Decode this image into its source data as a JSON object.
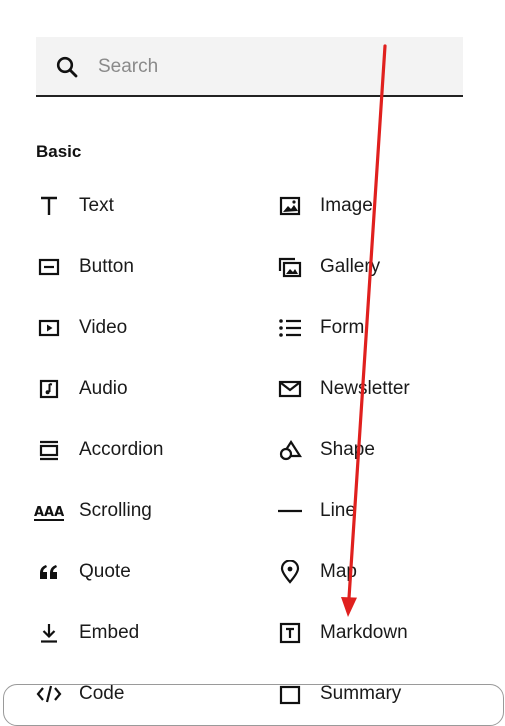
{
  "search": {
    "placeholder": "Search",
    "icon": "search-icon"
  },
  "section": {
    "title": "Basic"
  },
  "left_items": [
    {
      "label": "Text",
      "icon": "text-icon"
    },
    {
      "label": "Button",
      "icon": "button-icon"
    },
    {
      "label": "Video",
      "icon": "video-icon"
    },
    {
      "label": "Audio",
      "icon": "audio-icon"
    },
    {
      "label": "Accordion",
      "icon": "accordion-icon"
    },
    {
      "label": "Scrolling",
      "icon": "scrolling-icon"
    },
    {
      "label": "Quote",
      "icon": "quote-icon"
    },
    {
      "label": "Embed",
      "icon": "embed-icon"
    },
    {
      "label": "Code",
      "icon": "code-icon"
    }
  ],
  "right_items": [
    {
      "label": "Image",
      "icon": "image-icon"
    },
    {
      "label": "Gallery",
      "icon": "gallery-icon"
    },
    {
      "label": "Form",
      "icon": "form-icon"
    },
    {
      "label": "Newsletter",
      "icon": "newsletter-icon"
    },
    {
      "label": "Shape",
      "icon": "shape-icon"
    },
    {
      "label": "Line",
      "icon": "line-icon"
    },
    {
      "label": "Map",
      "icon": "map-icon"
    },
    {
      "label": "Markdown",
      "icon": "markdown-icon"
    },
    {
      "label": "Summary",
      "icon": "summary-icon"
    }
  ],
  "colors": {
    "annotation_arrow": "#e0201e",
    "search_bg": "#f3f3f3",
    "text": "#111111"
  }
}
